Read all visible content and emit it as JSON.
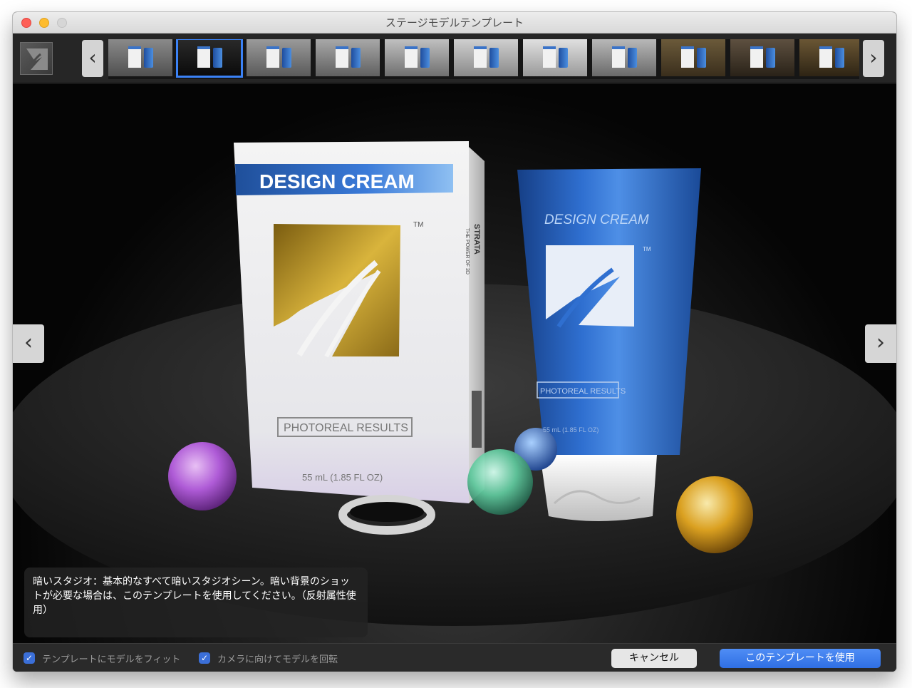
{
  "window": {
    "title": "ステージモデルテンプレート"
  },
  "thumbnails": {
    "count": 11,
    "selected_index": 1
  },
  "scene": {
    "box_heading": "DESIGN CREAM",
    "box_tagline": "PHOTOREAL RESULTS",
    "box_volume": "55 mL (1.85 FL OZ)",
    "box_tm": "TM",
    "box_side_brand": "STRATA",
    "box_side_sub": "THE POWER OF 3D",
    "tube_heading": "DESIGN CREAM",
    "tube_tagline": "PHOTOREAL RESULTS",
    "tube_volume": "55 mL (1.85 FL OZ)",
    "tube_tm": "TM"
  },
  "caption": {
    "text": "暗いスタジオ：基本的なすべて暗いスタジオシーン。暗い背景のショットが必要な場合は、このテンプレートを使用してください。（反射属性使用）"
  },
  "options": {
    "fit_model_label": "テンプレートにモデルをフィット",
    "fit_model_checked": true,
    "rotate_model_label": "カメラに向けてモデルを回転",
    "rotate_model_checked": true
  },
  "buttons": {
    "cancel_label": "キャンセル",
    "use_label": "このテンプレートを使用"
  },
  "icons": {
    "check": "✓",
    "chevron_left": "‹",
    "chevron_right": "›"
  },
  "colors": {
    "accent": "#3b82f6",
    "gold": "#b8921f",
    "tube_blue": "#2a63b8"
  }
}
